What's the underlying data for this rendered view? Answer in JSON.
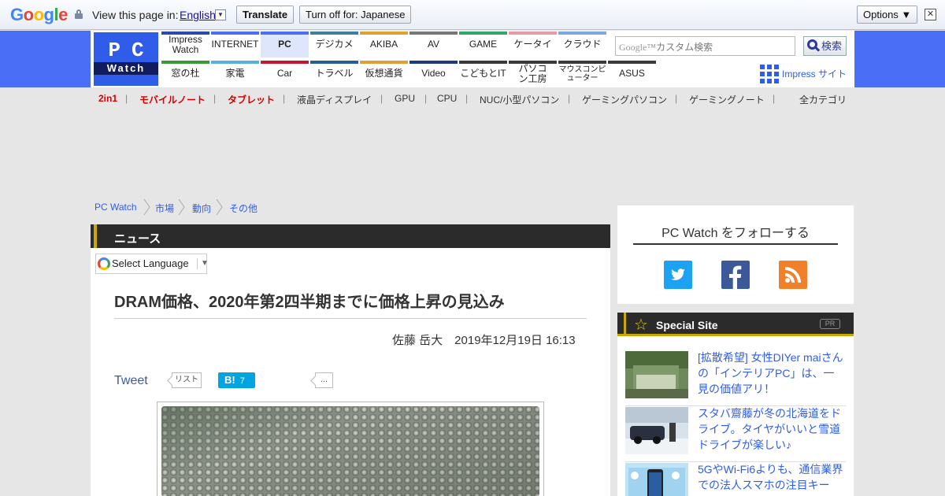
{
  "google_bar": {
    "logo": [
      "G",
      "o",
      "o",
      "g",
      "l",
      "e"
    ],
    "view_text": "View this page in:",
    "language": "English",
    "translate_label": "Translate",
    "turnoff_label": "Turn off for: Japanese",
    "options_label": "Options ▼",
    "close_label": "✕"
  },
  "header": {
    "logo_top": "PC",
    "logo_bottom": "Watch",
    "nav_top": [
      {
        "label": "Impress Watch",
        "color": "#2b4ba8"
      },
      {
        "label": "INTERNET",
        "color": "#4a6ff6"
      },
      {
        "label": "PC",
        "color": "#4a6ff6"
      },
      {
        "label": "デジカメ",
        "color": "#3d7f9c"
      },
      {
        "label": "AKIBA",
        "color": "#e0a030"
      },
      {
        "label": "AV",
        "color": "#777777"
      },
      {
        "label": "GAME",
        "color": "#2fa86a"
      },
      {
        "label": "ケータイ",
        "color": "#e59aa9"
      },
      {
        "label": "クラウド",
        "color": "#7aa8e0"
      }
    ],
    "nav_bottom": [
      {
        "label": "窓の杜",
        "color": "#3a9a3a"
      },
      {
        "label": "家電",
        "color": "#58b0e0"
      },
      {
        "label": "Car",
        "color": "#c01830"
      },
      {
        "label": "トラベル",
        "color": "#2a5e8c"
      },
      {
        "label": "仮想通貨",
        "color": "#e0a030"
      },
      {
        "label": "Video",
        "color": "#1f3a7a"
      },
      {
        "label": "こどもとIT",
        "color": "#3a3a3a"
      },
      {
        "label": "パソコン工房",
        "color": "#3a3a3a"
      },
      {
        "label": "マウスコンピューター",
        "color": "#3a3a3a"
      },
      {
        "label": "ASUS",
        "color": "#3a3a3a"
      }
    ],
    "search_google": "Google™",
    "search_placeholder": "カスタム検索",
    "search_button": "検索",
    "impress_site": "Impress サイト"
  },
  "categories": {
    "items": [
      "2in1",
      "モバイルノート",
      "タブレット",
      "液晶ディスプレイ",
      "GPU",
      "CPU",
      "NUC/小型パソコン",
      "ゲーミングパソコン",
      "ゲーミングノート"
    ],
    "all": "全カテゴリ"
  },
  "breadcrumb": [
    "PC Watch",
    "市場",
    "動向",
    "その他"
  ],
  "article": {
    "section": "ニュース",
    "select_language": "Select Language",
    "title": "DRAM価格、2020年第2四半期までに価格上昇の見込み",
    "byline": "佐藤 岳大　2019年12月19日 16:13",
    "tweet": "Tweet",
    "list_label": "リスト",
    "hatena_label": "B!",
    "hatena_count": "7",
    "more_label": "..."
  },
  "sidebar": {
    "follow_title": "PC Watch をフォローする",
    "special_title": "Special Site",
    "pr_badge": "PR",
    "items": [
      {
        "text": "[拡散希望] 女性DIYer maiさんの「インテリアPC」は、一見の価値アリ！"
      },
      {
        "text": "スタバ齋藤が冬の北海道をドライブ。タイヤがいいと雪道ドライブが楽しい♪"
      },
      {
        "text": "5GやWi-Fi6よりも、通信業界での法人スマホの注目キー"
      }
    ]
  }
}
